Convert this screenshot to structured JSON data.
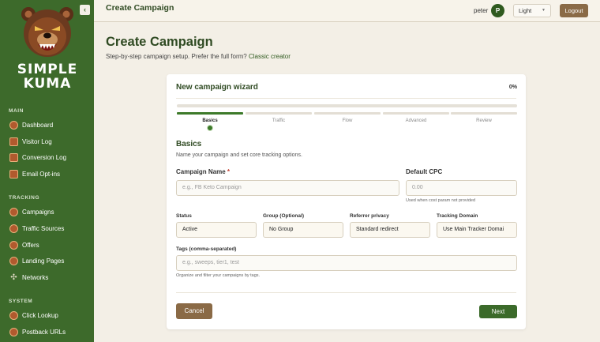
{
  "sidebar": {
    "logo_line1": "SIMPLE",
    "logo_line2": "KUMA",
    "collapse_icon": "‹",
    "sections": {
      "main": "MAIN",
      "tracking": "TRACKING",
      "system": "SYSTEM"
    },
    "main_items": [
      {
        "label": "Dashboard",
        "icon": "dashboard-icon"
      },
      {
        "label": "Visitor Log",
        "icon": "visitor-log-icon"
      },
      {
        "label": "Conversion Log",
        "icon": "conversion-log-icon"
      },
      {
        "label": "Email Opt-ins",
        "icon": "email-optins-icon"
      }
    ],
    "tracking_items": [
      {
        "label": "Campaigns",
        "icon": "campaigns-icon"
      },
      {
        "label": "Traffic Sources",
        "icon": "traffic-sources-icon"
      },
      {
        "label": "Offers",
        "icon": "offers-icon"
      },
      {
        "label": "Landing Pages",
        "icon": "landing-pages-icon"
      },
      {
        "label": "Networks",
        "icon": "networks-icon"
      }
    ],
    "system_items": [
      {
        "label": "Click Lookup",
        "icon": "click-lookup-icon"
      },
      {
        "label": "Postback URLs",
        "icon": "postback-urls-icon"
      }
    ]
  },
  "topbar": {
    "title": "Create Campaign",
    "user_name": "peter",
    "avatar_initial": "P",
    "theme_value": "Light",
    "logout_label": "Logout"
  },
  "page": {
    "heading": "Create Campaign",
    "subtitle": "Step-by-step campaign setup. Prefer the full form?",
    "subtitle_link": "Classic creator"
  },
  "wizard": {
    "title": "New campaign wizard",
    "progress_label": "0%",
    "progress": 0,
    "steps": [
      "Basics",
      "Traffic",
      "Flow",
      "Advanced",
      "Review"
    ],
    "active_step": 0,
    "section_title": "Basics",
    "section_desc": "Name your campaign and set core tracking options.",
    "campaign_name_label": "Campaign Name",
    "required_mark": "*",
    "campaign_name_placeholder": "e.g., FB Keto Campaign",
    "default_cpc_label": "Default CPC",
    "default_cpc_placeholder": "0.00",
    "default_cpc_hint": "Used when cost param not provided",
    "status_label": "Status",
    "status_value": "Active",
    "group_label": "Group (Optional)",
    "group_value": "No Group",
    "referrer_label": "Referrer privacy",
    "referrer_value": "Standard redirect",
    "domain_label": "Tracking Domain",
    "domain_value": "Use Main Tracker Domai",
    "tags_label": "Tags (comma-separated)",
    "tags_placeholder": "e.g., sweeps, tier1, test",
    "tags_hint": "Organize and filter your campaigns by tags.",
    "cancel_label": "Cancel",
    "next_label": "Next"
  },
  "colors": {
    "sidebar": "#3d6a2b",
    "accent_green": "#3d7a2a",
    "brown_button": "#8a6a46",
    "background": "#f3efe6"
  }
}
